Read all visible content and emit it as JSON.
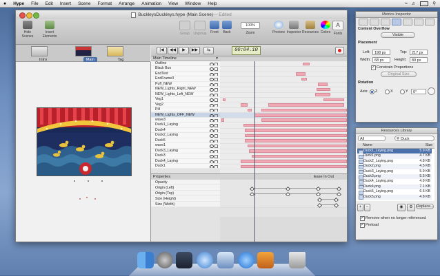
{
  "menubar": {
    "apple": "",
    "items": [
      "Hype",
      "File",
      "Edit",
      "Insert",
      "Scene",
      "Format",
      "Arrange",
      "Animation",
      "View",
      "Window",
      "Help"
    ]
  },
  "window": {
    "title": "BuckleysDuckleys.hype (Main Scene)",
    "edited": " — Edited",
    "toolbar": {
      "hide_scenes": "Hide Scenes",
      "insert_elements": "Insert Elements",
      "group": "Group",
      "ungroup": "Ungroup",
      "front": "Front",
      "back": "Back",
      "zoom_value": "100%",
      "zoom": "Zoom",
      "preview": "Preview",
      "inspector": "Inspector",
      "resources": "Resources",
      "colors": "Colors",
      "fonts": "Fonts"
    },
    "scenes": [
      {
        "label": "Intro",
        "active": false
      },
      {
        "label": "Main Scene",
        "active": true
      },
      {
        "label": "Tag Line",
        "active": false
      }
    ]
  },
  "timeline": {
    "timecode": "00:04.10",
    "header": "Main Timeline",
    "layers": [
      "Outline",
      "Black Box",
      "EndText",
      "EndFrame3",
      "Puff_NEW",
      "NEW_Lights_Right_NEW",
      "NEW_Lights_Left_NEW",
      "Veg1",
      "Veg2",
      "Pill",
      "NEW_Lights_OFF_NEW",
      "wave3",
      "Duck1_Laying",
      "Duck4",
      "Duck2_Laying",
      "Duck5",
      "wave1",
      "Duck3_Laying",
      "Duck3",
      "Duck4_Laying",
      "Duck1"
    ],
    "selected_layer_index": 10,
    "properties_header": "Properties",
    "easing": "Ease In Out",
    "properties": [
      "Opacity",
      "Origin (Left)",
      "Origin (Top)",
      "Size (Height)",
      "Size (Width)"
    ]
  },
  "inspector": {
    "title": "Metrics Inspector",
    "content_overflow_label": "Content Overflow",
    "content_overflow_value": "Visible",
    "placement_label": "Placement",
    "left_label": "Left:",
    "left_value": "198 px",
    "top_label": "Top:",
    "top_value": "217 px",
    "width_label": "Width:",
    "width_value": "68 px",
    "height_label": "Height:",
    "height_value": "89 px",
    "constrain_label": "Constrain Proportions",
    "original_size_label": "Original Size",
    "rotation_label": "Rotation",
    "axis_label": "Axis:",
    "axis_z": "Z",
    "axis_x": "X",
    "axis_y": "Y",
    "rotation_value": "0°"
  },
  "resources": {
    "title": "Resources Library",
    "filter_value": "All",
    "search_value": "Duck",
    "col_name": "Name",
    "col_size": "Size",
    "files": [
      {
        "name": "Duck1_Laying.png",
        "size": "5.9 KB"
      },
      {
        "name": "Duck1.png",
        "size": "4.7 KB"
      },
      {
        "name": "Duck2_Laying.png",
        "size": "4.8 KB"
      },
      {
        "name": "Duck2.png",
        "size": "4.5 KB"
      },
      {
        "name": "Duck3_Laying.png",
        "size": "5.9 KB"
      },
      {
        "name": "Duck3.png",
        "size": "5.5 KB"
      },
      {
        "name": "Duck4_Laying.png",
        "size": "4.9 KB"
      },
      {
        "name": "Duck4.png",
        "size": "7.1 KB"
      },
      {
        "name": "Duck5_Laying.png",
        "size": "6.6 KB"
      },
      {
        "name": "Duck5.png",
        "size": "4.8 KB"
      }
    ],
    "replace_label": "Replace...",
    "remove_label": "Remove when no longer referenced",
    "preload_label": "Preload"
  },
  "colors": {
    "accent": "#4b6fa8",
    "bar": "#f0a8b4",
    "timecode_bg": "#e5ecc6"
  }
}
